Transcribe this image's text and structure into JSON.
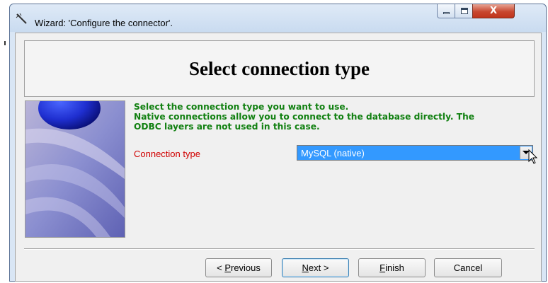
{
  "window": {
    "title": "Wizard: 'Configure the connector'.",
    "close_glyph": "X"
  },
  "header": {
    "title": "Select connection type"
  },
  "instructions": {
    "line1": "Select the connection type you want to use.",
    "line2": "Native connections allow you to connect to the database directly. The",
    "line3": "ODBC layers are not used in this case."
  },
  "connection": {
    "label": "Connection type",
    "value": "MySQL (native)"
  },
  "buttons": {
    "previous_prefix": "< ",
    "previous_mnemonic": "P",
    "previous_rest": "revious",
    "next_mnemonic": "N",
    "next_rest": "ext >",
    "finish_mnemonic": "F",
    "finish_rest": "inish",
    "cancel": "Cancel"
  },
  "colors": {
    "instructions_text": "#118011",
    "label_text": "#d00000",
    "selection_highlight": "#3399ff",
    "close_button": "#c8472f"
  },
  "icons": {
    "app_icon": "wizard-wand-icon",
    "minimize": "minimize-icon",
    "maximize": "maximize-icon",
    "close": "close-icon",
    "dropdown": "chevron-down-icon",
    "cursor": "mouse-pointer-icon"
  }
}
